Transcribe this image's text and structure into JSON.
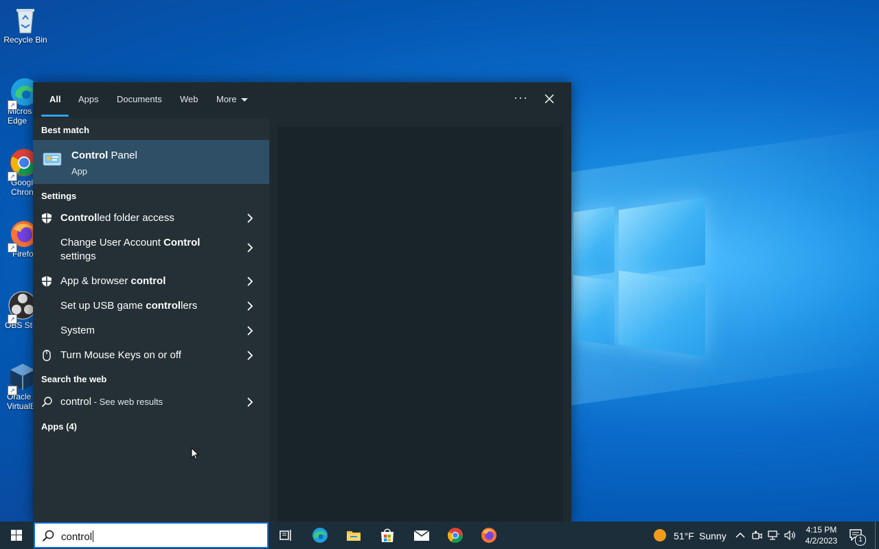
{
  "desktop": {
    "icons": [
      {
        "label": "Recycle Bin"
      },
      {
        "label": "Microsoft Edge",
        "visible_label": "Micros\nEdge"
      },
      {
        "label": "Google Chrome",
        "visible_label": "Googl\nChron"
      },
      {
        "label": "Firefox",
        "visible_label": "Firefo"
      },
      {
        "label": "OBS Studio",
        "visible_label": "OBS Stu"
      },
      {
        "label": "Oracle VM VirtualBox",
        "visible_label": "Oracle\nVirtualE"
      }
    ]
  },
  "search_panel": {
    "tabs": [
      {
        "label": "All",
        "active": true
      },
      {
        "label": "Apps"
      },
      {
        "label": "Documents"
      },
      {
        "label": "Web"
      },
      {
        "label": "More"
      }
    ],
    "ellipsis": "···",
    "best_match_heading": "Best match",
    "best_match": {
      "title_bold": "Control",
      "title_rest": " Panel",
      "subtitle": "App",
      "icon": "control-panel-icon"
    },
    "settings_heading": "Settings",
    "settings": [
      {
        "pre": "",
        "bold": "Control",
        "post": "led folder access",
        "icon": "shield-icon"
      },
      {
        "pre": "Change User Account ",
        "bold": "Control",
        "post": " settings",
        "icon": ""
      },
      {
        "pre": "App & browser ",
        "bold": "control",
        "post": "",
        "icon": "shield-icon"
      },
      {
        "pre": "Set up USB game ",
        "bold": "control",
        "post": "lers",
        "icon": ""
      },
      {
        "pre": "System",
        "bold": "",
        "post": "",
        "icon": ""
      },
      {
        "pre": "Turn Mouse Keys on or off",
        "bold": "",
        "post": "",
        "icon": "mouse-icon"
      }
    ],
    "web_heading": "Search the web",
    "web_result": {
      "query": "control",
      "suffix": " - See web results"
    },
    "apps_heading": "Apps (4)"
  },
  "taskbar": {
    "search_value": "control",
    "pinned": [
      "task-view-icon",
      "edge-icon",
      "file-explorer-icon",
      "store-icon",
      "mail-icon",
      "chrome-icon",
      "firefox-icon"
    ],
    "weather": {
      "temp": "51°F",
      "condition": "Sunny"
    },
    "time": "4:15 PM",
    "date": "4/2/2023",
    "notification_count": "1"
  },
  "colors": {
    "accent": "#3aa0f3",
    "highlight": "#2f4f66",
    "panel": "#1f2a30"
  }
}
